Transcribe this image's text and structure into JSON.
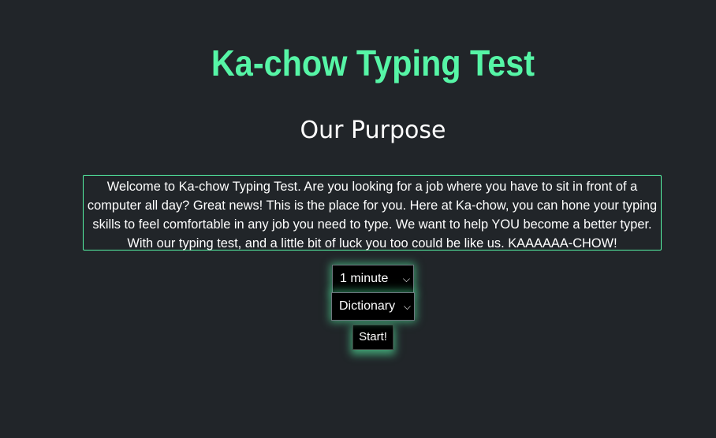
{
  "header": {
    "title": "Ka-chow Typing Test",
    "subtitle": "Our Purpose"
  },
  "purpose": {
    "text": "Welcome to Ka-chow Typing Test. Are you looking for a job where you have to sit in front of a computer all day? Great news! This is the place for you. Here at Ka-chow, you can hone your typing skills to feel comfortable in any job you need to type. We want to help YOU become a better typer. With our typing test, and a little bit of luck you too could be like us. KAAAAAA-CHOW!"
  },
  "controls": {
    "duration_selected": "1 minute",
    "wordlist_selected": "Dictionary",
    "start_label": "Start!"
  },
  "colors": {
    "background": "#212529",
    "accent": "#56f5a6",
    "text": "#ffffff",
    "control_background": "#000000"
  },
  "icons": {
    "dropdown": "chevron-down-icon"
  }
}
